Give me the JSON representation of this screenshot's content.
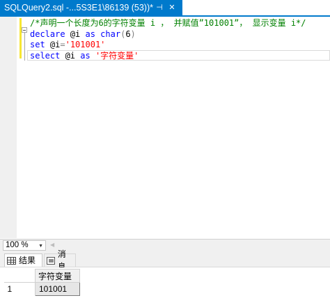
{
  "tab": {
    "title": "SQLQuery2.sql -...5S3E1\\86139 (53))*",
    "pin_icon": "pin-icon",
    "close_icon": "close-icon"
  },
  "editor": {
    "lines": [
      [
        {
          "t": "/*声明一个长度为6的字符变量 i ， 并赋值”101001”， 显示变量 i*/",
          "c": "cmt"
        }
      ],
      [
        {
          "t": "declare",
          "c": "kw"
        },
        {
          "t": " @i ",
          "c": "var"
        },
        {
          "t": "as",
          "c": "kw"
        },
        {
          "t": " ",
          "c": "var"
        },
        {
          "t": "char",
          "c": "kw"
        },
        {
          "t": "(",
          "c": "op"
        },
        {
          "t": "6",
          "c": "num"
        },
        {
          "t": ")",
          "c": "op"
        }
      ],
      [
        {
          "t": "set",
          "c": "kw"
        },
        {
          "t": " @i",
          "c": "var"
        },
        {
          "t": "=",
          "c": "op"
        },
        {
          "t": "'101001'",
          "c": "str"
        }
      ],
      [
        {
          "t": "select",
          "c": "kw"
        },
        {
          "t": " @i ",
          "c": "var"
        },
        {
          "t": "as",
          "c": "kw"
        },
        {
          "t": " ",
          "c": "var"
        },
        {
          "t": "'字符变量'",
          "c": "str"
        }
      ]
    ]
  },
  "zoom": {
    "value": "100 %",
    "dropdown_icon": "dropdown-arrow-icon"
  },
  "results_tabs": [
    {
      "label": "结果",
      "icon": "grid-icon",
      "active": true
    },
    {
      "label": "消息",
      "icon": "message-icon",
      "active": false
    }
  ],
  "results_grid": {
    "columns": [
      "字符变量"
    ],
    "rows": [
      {
        "row_number": "1",
        "values": [
          "101001"
        ]
      }
    ]
  },
  "colors": {
    "accent": "#007acc",
    "keyword": "#0000ff",
    "comment": "#008000",
    "string": "#ff0000",
    "change_marker": "#f7e632"
  }
}
